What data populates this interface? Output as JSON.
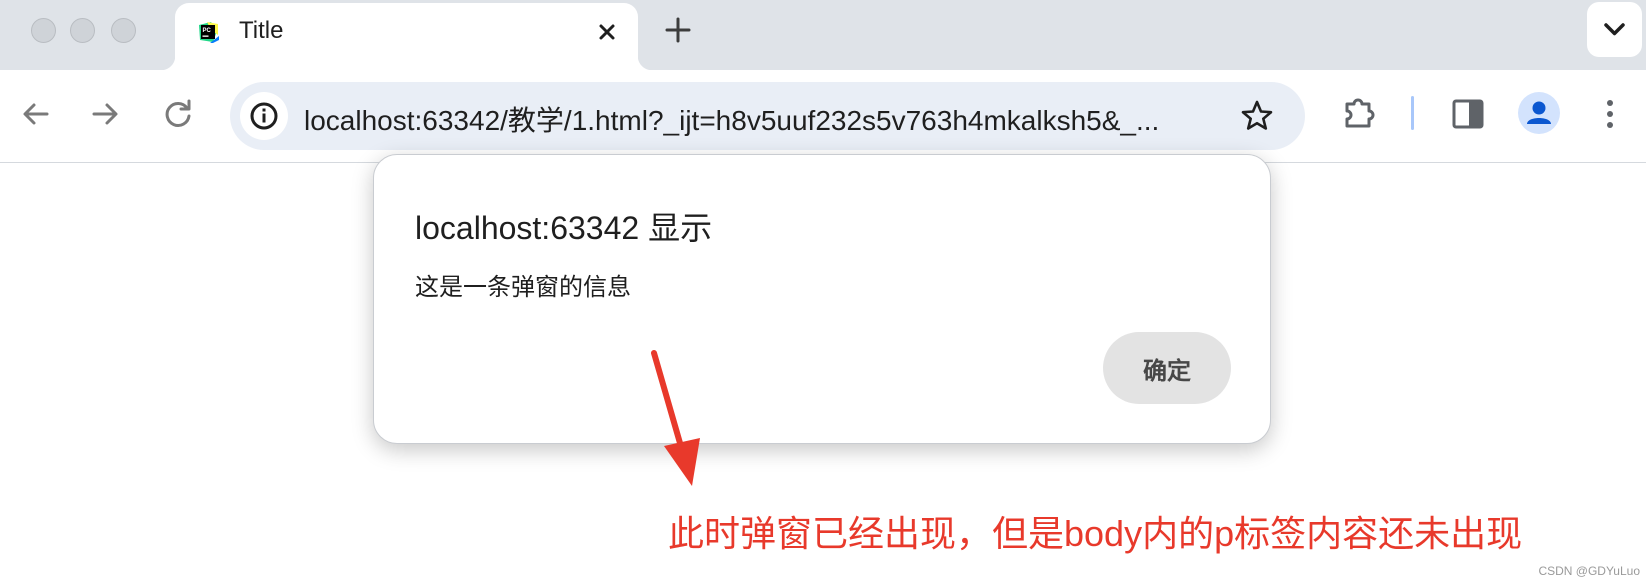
{
  "browser": {
    "tab": {
      "title": "Title",
      "favicon": "pycharm-icon"
    },
    "address_bar": {
      "url": "localhost:63342/教学/1.html?_ijt=h8v5uuf232s5v763h4mkalksh5&_...",
      "site_info_icon": "info-icon"
    },
    "toolbar_icons": [
      "back-arrow-icon",
      "forward-arrow-icon",
      "reload-icon",
      "star-icon",
      "puzzle-extension-icon",
      "side-panel-icon",
      "avatar-icon",
      "kebab-menu-icon"
    ]
  },
  "dialog": {
    "title": "localhost:63342 显示",
    "message": "这是一条弹窗的信息",
    "ok_label": "确定"
  },
  "annotation": {
    "text": "此时弹窗已经出现，但是body内的p标签内容还未出现",
    "color": "#e8392b"
  },
  "watermark": "CSDN @GDYuLuo",
  "colors": {
    "tabstrip_bg": "#dfe3e8",
    "omnibox_bg": "#e9eef6",
    "accent_blue": "#0b57d0",
    "annotation_red": "#e8392b"
  }
}
